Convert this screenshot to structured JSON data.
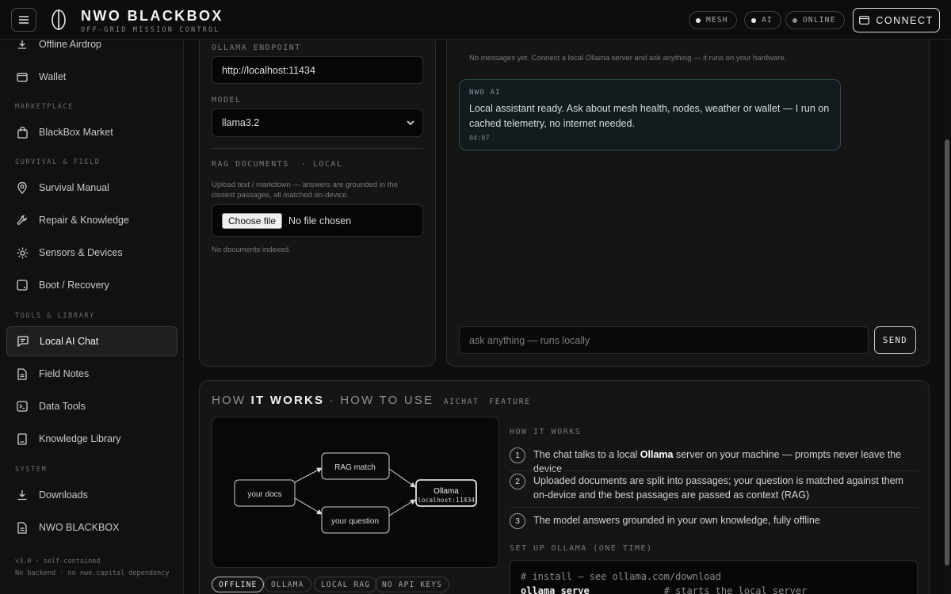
{
  "header": {
    "brand": "NWO BLACKBOX",
    "subtitle": "OFF-GRID MISSION CONTROL",
    "status_pills": [
      "MESH",
      "AI",
      "ONLINE"
    ],
    "connect_label": "CONNECT"
  },
  "sidebar": {
    "items_top": [
      {
        "label": "Offline Airdrop",
        "icon": "airdrop-icon"
      },
      {
        "label": "Wallet",
        "icon": "wallet-icon"
      }
    ],
    "sections": [
      {
        "title": "MARKETPLACE",
        "items": [
          {
            "label": "BlackBox Market",
            "icon": "shopping-bag-icon"
          }
        ]
      },
      {
        "title": "SURVIVAL & FIELD",
        "items": [
          {
            "label": "Survival Manual",
            "icon": "map-pin-icon"
          },
          {
            "label": "Repair & Knowledge",
            "icon": "wrench-icon"
          },
          {
            "label": "Sensors & Devices",
            "icon": "sensor-icon"
          },
          {
            "label": "Boot / Recovery",
            "icon": "disk-icon"
          }
        ]
      },
      {
        "title": "TOOLS & LIBRARY",
        "items": [
          {
            "label": "Local AI Chat",
            "icon": "chat-icon",
            "active": true
          },
          {
            "label": "Field Notes",
            "icon": "document-icon"
          },
          {
            "label": "Data Tools",
            "icon": "terminal-icon"
          },
          {
            "label": "Knowledge Library",
            "icon": "book-icon"
          }
        ]
      },
      {
        "title": "SYSTEM",
        "items": [
          {
            "label": "Downloads",
            "icon": "download-icon"
          },
          {
            "label": "NWO BLACKBOX",
            "icon": "document-icon"
          }
        ]
      }
    ],
    "footer": [
      "v3.0 · self-contained",
      "No backend · no nwo.capital dependency"
    ]
  },
  "settings": {
    "endpoint_label": "OLLAMA ENDPOINT",
    "endpoint_value": "http://localhost:11434",
    "model_label": "MODEL",
    "model_value": "llama3.2",
    "rag_label": "RAG DOCUMENTS",
    "rag_tag": "· LOCAL",
    "rag_hint": "Upload text / markdown — answers are grounded in the closest passages, all matched on-device.",
    "choose_file": "Choose file",
    "no_file": "No file chosen",
    "no_docs": "No documents indexed."
  },
  "chat": {
    "empty_note": "No messages yet. Connect a local Ollama server and ask anything — it runs on your hardware.",
    "message": {
      "sender": "NWO AI",
      "text": "Local assistant ready. Ask about mesh health, nodes, weather or wallet — I run on cached telemetry, no internet needed.",
      "time": "04:07"
    },
    "input_placeholder": "ask anything — runs locally",
    "send_label": "SEND"
  },
  "how": {
    "title_a": "HOW",
    "title_b": "IT WORKS",
    "title_sep": "·",
    "title_c": "HOW TO USE",
    "tag1": "AICHAT",
    "tag2": "FEATURE",
    "diagram": {
      "docs": "your docs",
      "rag": "RAG match",
      "question": "your question",
      "ollama": "Ollama",
      "ollama_sub": "localhost:11434"
    },
    "chips": [
      "OFFLINE",
      "OLLAMA",
      "LOCAL RAG",
      "NO API KEYS"
    ],
    "steps_title": "HOW IT WORKS",
    "steps": [
      {
        "num": "1",
        "pre": "The chat talks to a local ",
        "bold": "Ollama",
        "post": " server on your machine — prompts never leave the device"
      },
      {
        "num": "2",
        "pre": "Uploaded documents are split into passages; your question is matched against them on-device and the best passages are passed as context (RAG)",
        "bold": "",
        "post": ""
      },
      {
        "num": "3",
        "pre": "The model answers grounded in your own knowledge, fully offline",
        "bold": "",
        "post": ""
      }
    ],
    "setup_title": "SET UP OLLAMA (ONE TIME)",
    "code_line1": "# install — see ollama.com/download",
    "code_cmd": "ollama serve",
    "code_comment": "# starts the local server"
  }
}
